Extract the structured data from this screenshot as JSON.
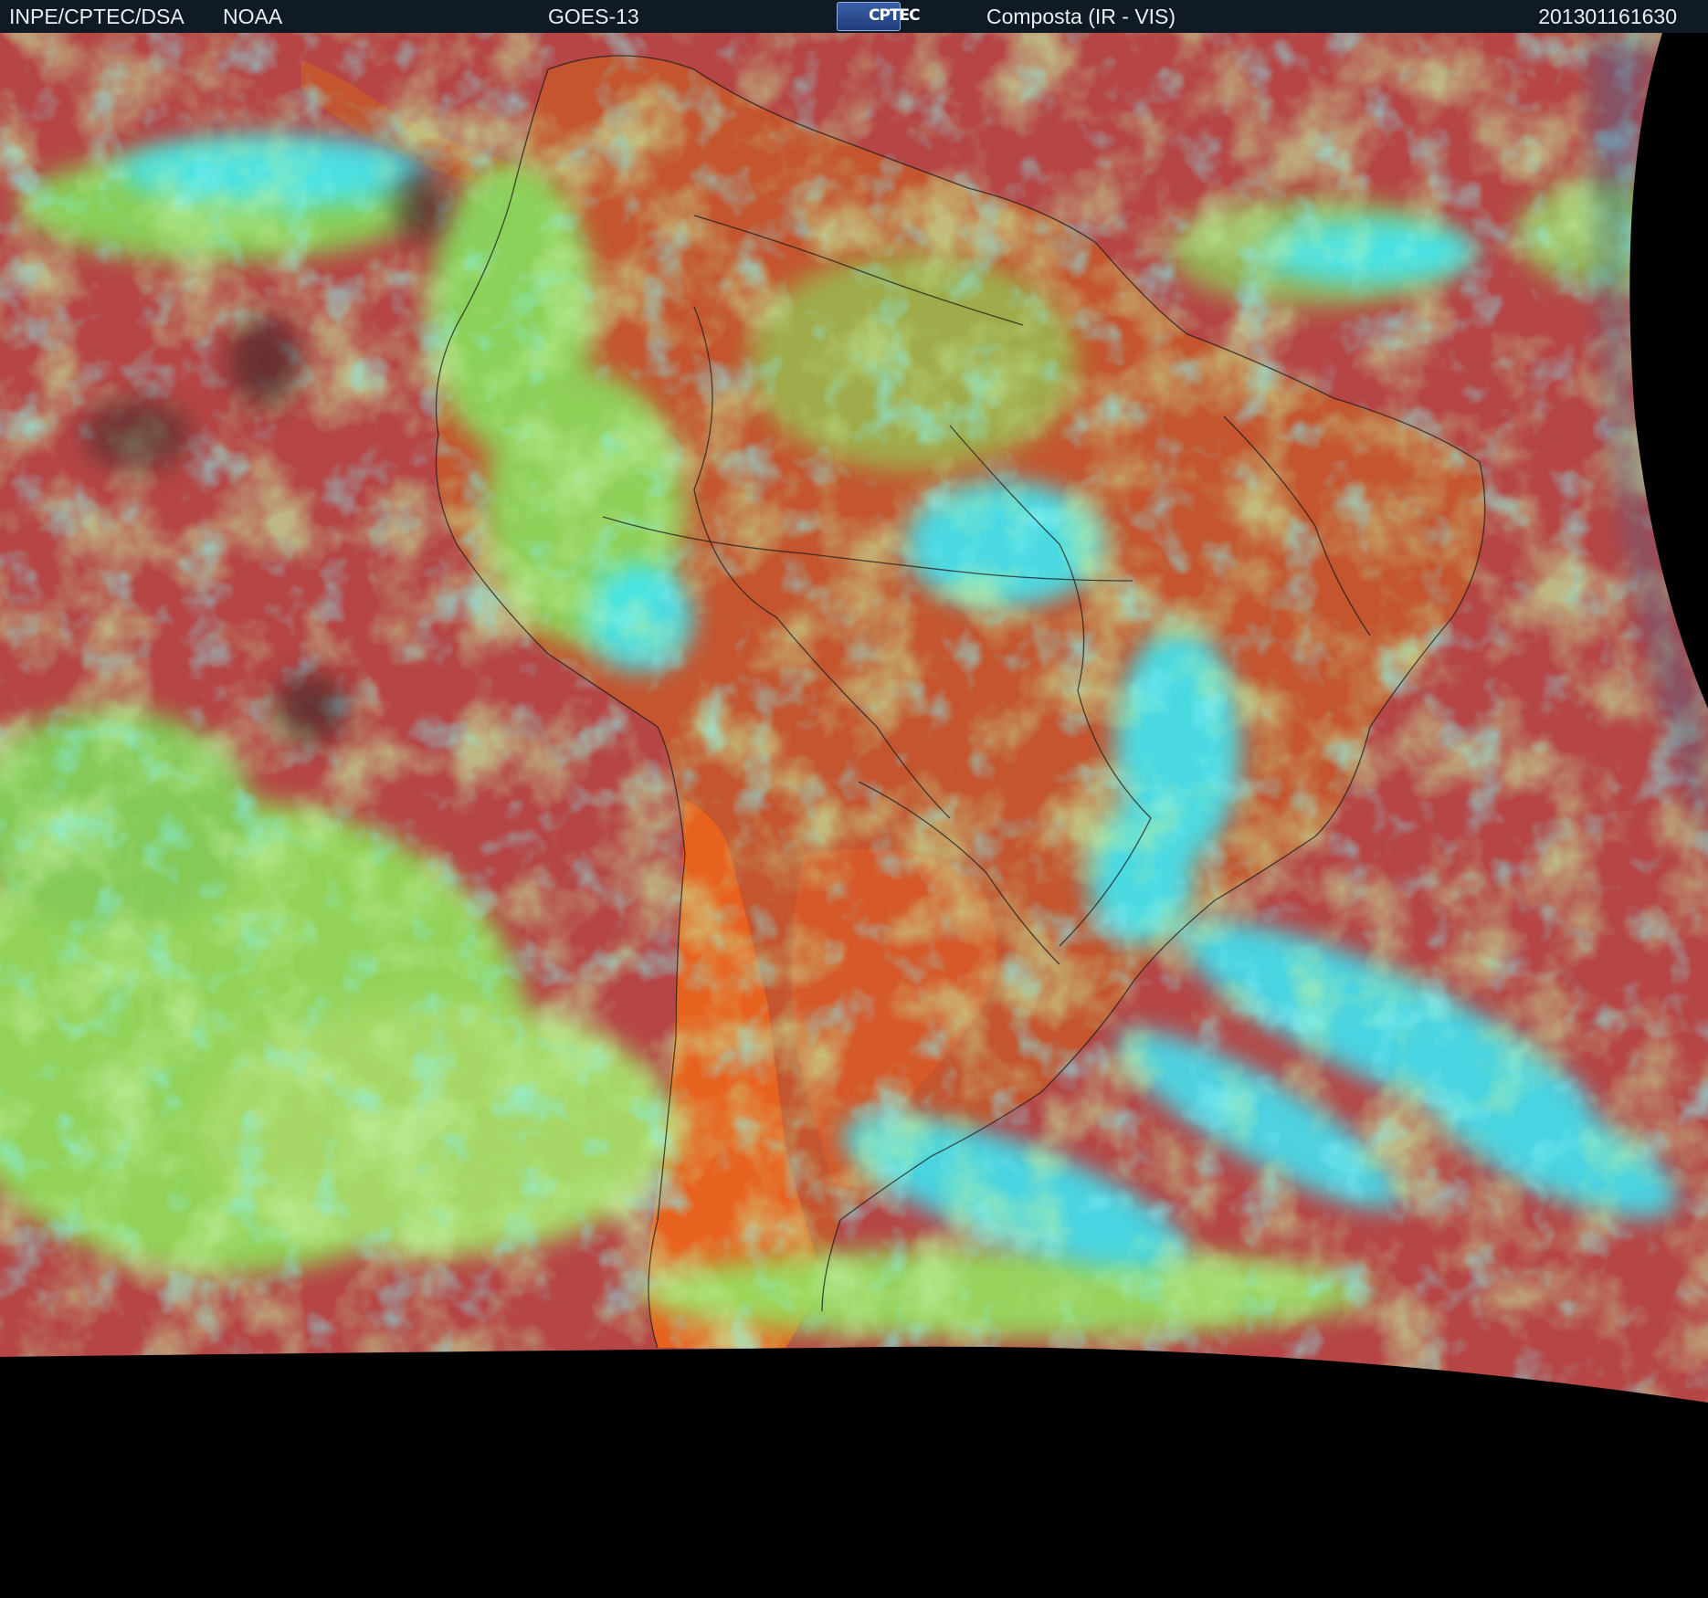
{
  "header": {
    "organization": "INPE/CPTEC/DSA",
    "agency": "NOAA",
    "satellite": "GOES-13",
    "logo_text": "CPTEC",
    "product": "Composta (IR - VIS)",
    "timestamp": "201301161630"
  },
  "colors": {
    "header_bg": "#0f1a24",
    "ocean_clear": "#b84545",
    "land_clear": "#c8572f",
    "desert": "#e8621f",
    "low_cloud": "#8fe860",
    "high_cloud": "#3ee6f0",
    "no_data": "#000000"
  }
}
